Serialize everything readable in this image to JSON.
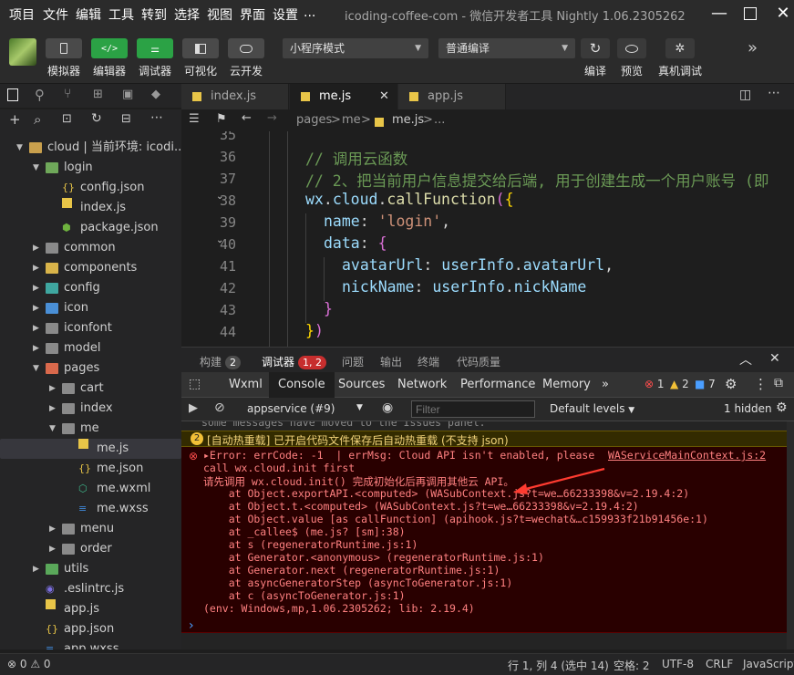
{
  "menu": [
    "项目",
    "文件",
    "编辑",
    "工具",
    "转到",
    "选择",
    "视图",
    "界面",
    "设置",
    "..."
  ],
  "window_title": "icoding-coffee-com - 微信开发者工具 Nightly 1.06.2305262",
  "toolbar": {
    "buttons": [
      {
        "label": "模拟器",
        "icon": "phone-icon"
      },
      {
        "label": "编辑器",
        "icon": "code-icon"
      },
      {
        "label": "调试器",
        "icon": "debug-sliders-icon"
      },
      {
        "label": "可视化",
        "icon": "layout-icon"
      },
      {
        "label": "云开发",
        "icon": "cloud-icon"
      }
    ],
    "mode_select": "小程序模式",
    "compile_select": "普通编译",
    "right_buttons": [
      {
        "label": "编译",
        "icon": "refresh-icon"
      },
      {
        "label": "预览",
        "icon": "eye-icon"
      },
      {
        "label": "真机调试",
        "icon": "bug-icon"
      }
    ]
  },
  "explorer": {
    "items": [
      {
        "label": "cloud | 当前环境: icodi...",
        "type": "folder-open",
        "depth": 0,
        "caret": "down"
      },
      {
        "label": "login",
        "type": "folder-open-green",
        "depth": 1,
        "caret": "down"
      },
      {
        "label": "config.json",
        "type": "json",
        "depth": 2
      },
      {
        "label": "index.js",
        "type": "js",
        "depth": 2
      },
      {
        "label": "package.json",
        "type": "pkg",
        "depth": 2
      },
      {
        "label": "common",
        "type": "folder",
        "depth": 1,
        "caret": "right"
      },
      {
        "label": "components",
        "type": "folder-yellow",
        "depth": 1,
        "caret": "right"
      },
      {
        "label": "config",
        "type": "folder-teal",
        "depth": 1,
        "caret": "right"
      },
      {
        "label": "icon",
        "type": "folder-blue",
        "depth": 1,
        "caret": "right"
      },
      {
        "label": "iconfont",
        "type": "folder",
        "depth": 1,
        "caret": "right"
      },
      {
        "label": "model",
        "type": "folder",
        "depth": 1,
        "caret": "right"
      },
      {
        "label": "pages",
        "type": "folder-red",
        "depth": 1,
        "caret": "down"
      },
      {
        "label": "cart",
        "type": "folder",
        "depth": 2,
        "caret": "right"
      },
      {
        "label": "index",
        "type": "folder",
        "depth": 2,
        "caret": "right"
      },
      {
        "label": "me",
        "type": "folder",
        "depth": 2,
        "caret": "down"
      },
      {
        "label": "me.js",
        "type": "js",
        "depth": 3,
        "selected": true
      },
      {
        "label": "me.json",
        "type": "json",
        "depth": 3
      },
      {
        "label": "me.wxml",
        "type": "wxml",
        "depth": 3
      },
      {
        "label": "me.wxss",
        "type": "wxss",
        "depth": 3
      },
      {
        "label": "menu",
        "type": "folder",
        "depth": 2,
        "caret": "right"
      },
      {
        "label": "order",
        "type": "folder",
        "depth": 2,
        "caret": "right"
      },
      {
        "label": "utils",
        "type": "folder-green",
        "depth": 1,
        "caret": "right"
      },
      {
        "label": ".eslintrc.js",
        "type": "eslint",
        "depth": 1
      },
      {
        "label": "app.js",
        "type": "js",
        "depth": 1
      },
      {
        "label": "app.json",
        "type": "json",
        "depth": 1
      },
      {
        "label": "app.wxss",
        "type": "wxss",
        "depth": 1
      }
    ]
  },
  "tabs": [
    {
      "label": "index.js",
      "active": false
    },
    {
      "label": "me.js",
      "active": true
    },
    {
      "label": "app.js",
      "active": false
    }
  ],
  "breadcrumb": [
    "pages",
    ">",
    "me",
    ">",
    "me.js",
    ">",
    "..."
  ],
  "code": {
    "line_numbers": [
      "35",
      "36",
      "37",
      "38",
      "39",
      "40",
      "41",
      "42",
      "43",
      "44"
    ],
    "lines": [
      "",
      "// 调用云函数",
      "// 2、把当前用户信息提交给后端, 用于创建生成一个用户账号 (即",
      "wx.cloud.callFunction({",
      "name: 'login',",
      "data: {",
      "avatarUrl: userInfo.avatarUrl,",
      "nickName: userInfo.nickName",
      "}",
      "})"
    ]
  },
  "panel": {
    "tabs": [
      {
        "label": "构建",
        "badge": "2"
      },
      {
        "label": "调试器",
        "badge": "1, 2",
        "active": true
      },
      {
        "label": "问题"
      },
      {
        "label": "输出"
      },
      {
        "label": "终端"
      },
      {
        "label": "代码质量"
      }
    ]
  },
  "devtools": {
    "tabs": [
      "Wxml",
      "Console",
      "Sources",
      "Network",
      "Performance",
      "Memory"
    ],
    "active_tab": "Console",
    "errors": "1",
    "warnings": "2",
    "infos": "7",
    "context": "appservice (#9)",
    "filter_placeholder": "Filter",
    "levels": "Default levels",
    "hidden": "1 hidden"
  },
  "console": {
    "clipped_line": "some messages have moved to the Issues panel.",
    "warning": "[自动热重载] 已开启代码文件保存后自动热重载 (不支持 json)",
    "error_lines": [
      "▸Error: errCode: -1  | errMsg: Cloud API isn't enabled, please",
      "call wx.cloud.init first",
      "请先调用 wx.cloud.init() 完成初始化后再调用其他云 API。",
      "    at Object.exportAPI.<computed> (WASubContext.js?t=we…66233398&v=2.19.4:2)",
      "    at Object.t.<computed> (WASubContext.js?t=we…66233398&v=2.19.4:2)",
      "    at Object.value [as callFunction] (apihook.js?t=wechat&…c159933f21b91456e:1)",
      "    at _callee$ (me.js? [sm]:38)",
      "    at s (regeneratorRuntime.js:1)",
      "    at Generator.<anonymous> (regeneratorRuntime.js:1)",
      "    at Generator.next (regeneratorRuntime.js:1)",
      "    at asyncGeneratorStep (asyncToGenerator.js:1)",
      "    at c (asyncToGenerator.js:1)",
      "(env: Windows,mp,1.06.2305262; lib: 2.19.4)"
    ],
    "source_link": "WAServiceMainContext.js:2",
    "prompt": "›"
  },
  "statusbar": {
    "errors": "0",
    "warnings": "0",
    "position": "行 1, 列 4 (选中 14)",
    "indent": "空格: 2",
    "encoding": "UTF-8",
    "eol": "CRLF",
    "language": "JavaScript"
  },
  "colors": {
    "accent_green": "#2ba245",
    "error_red": "#ff8080",
    "error_bg": "#290000",
    "warn_bg": "#332b00"
  }
}
